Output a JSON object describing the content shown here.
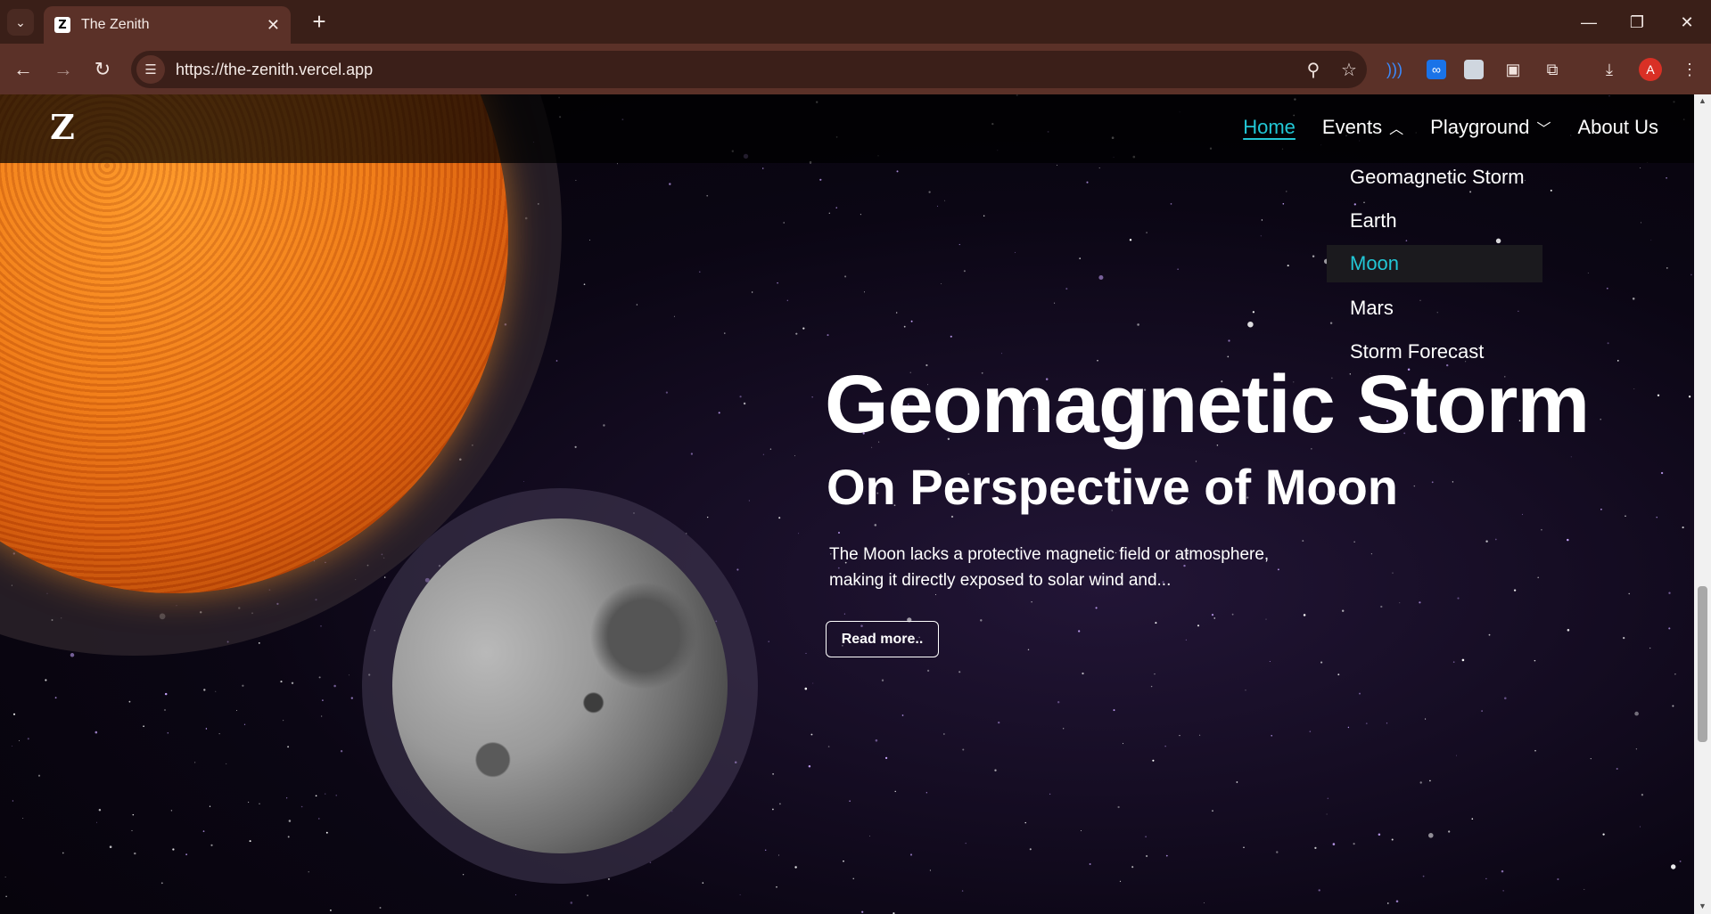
{
  "browser": {
    "tab_title": "The Zenith",
    "tab_favicon": "Z",
    "url": "https://the-zenith.vercel.app",
    "profile_initial": "A",
    "icons": {
      "tab_list": "chevron-down-icon",
      "close": "close-icon",
      "new_tab": "plus-icon",
      "back": "arrow-left-icon",
      "forward": "arrow-right-icon",
      "reload": "reload-icon",
      "zoom": "zoom-icon",
      "bookmark": "star-icon",
      "extensions": "puzzle-icon",
      "downloads": "download-icon",
      "menu": "kebab-icon"
    }
  },
  "site": {
    "logo": "Z",
    "nav": {
      "home": "Home",
      "events": "Events",
      "playground": "Playground",
      "about": "About Us"
    },
    "events_menu": [
      "Geomagnetic Storm",
      "Earth",
      "Moon",
      "Mars",
      "Storm Forecast"
    ],
    "events_selected": "Moon",
    "hero": {
      "title": "Geomagnetic Storm",
      "subtitle": "On Perspective of Moon",
      "description": "The Moon lacks a protective magnetic field or atmosphere, making it directly exposed to solar wind and...",
      "button": "Read more.."
    }
  },
  "colors": {
    "accent": "#22c7d6",
    "chrome": "#5b3128",
    "chrome_dark": "#3a1f18"
  }
}
